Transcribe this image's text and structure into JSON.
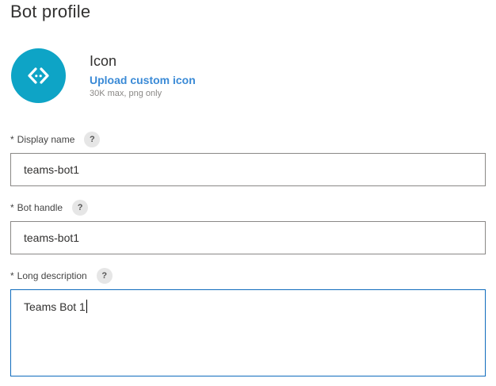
{
  "page": {
    "title": "Bot profile"
  },
  "icon_section": {
    "heading": "Icon",
    "upload_link": "Upload custom icon",
    "hint": "30K max, png only",
    "avatar_icon": "code-brackets-icon",
    "avatar_color": "#0ea4c6"
  },
  "fields": {
    "display_name": {
      "required_mark": "*",
      "label": "Display name",
      "help": "?",
      "value": "teams-bot1"
    },
    "bot_handle": {
      "required_mark": "*",
      "label": "Bot handle",
      "help": "?",
      "value": "teams-bot1"
    },
    "long_description": {
      "required_mark": "*",
      "label": "Long description",
      "help": "?",
      "value": "Teams Bot 1"
    }
  },
  "colors": {
    "link": "#3a8ad6",
    "focus_border": "#0f6cbd"
  }
}
